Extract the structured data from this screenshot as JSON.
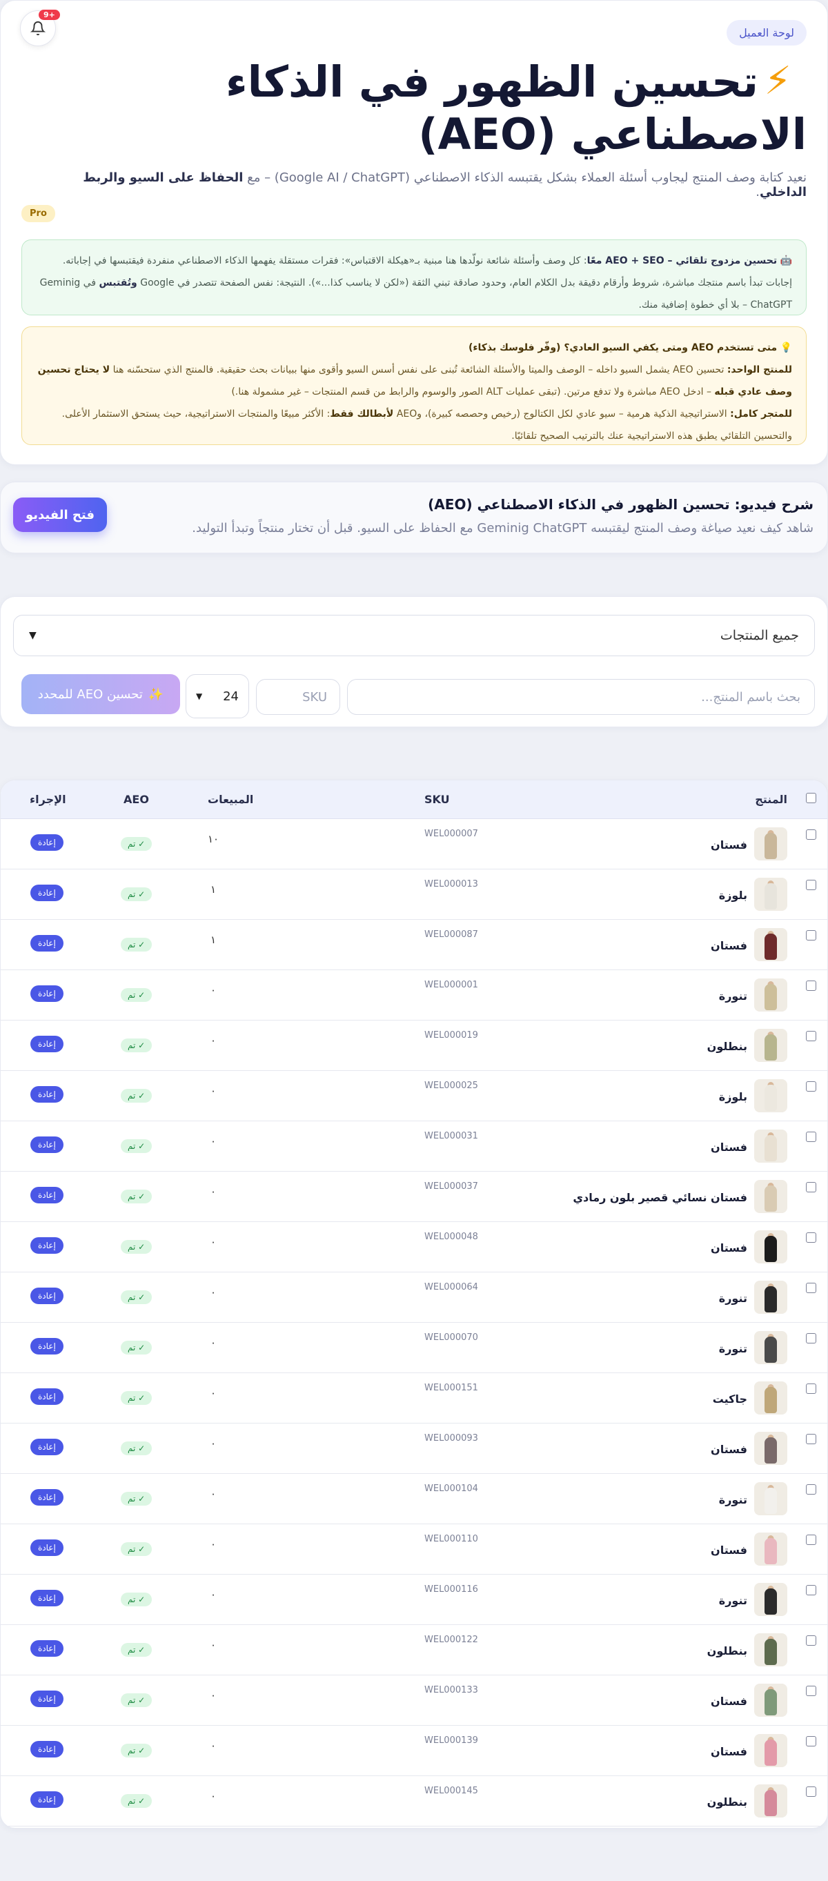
{
  "header": {
    "client_chip": "لوحة العميل",
    "notif_badge": "+9",
    "title_line1": "تحسين الظهور في الذكاء",
    "title_line2": "الاصطناعي (AEO)",
    "subtitle_pre": "نعيد كتابة وصف المنتج ليجاوب أسئلة العملاء بشكل يقتبسه الذكاء الاصطناعي (Google AI / ChatGPT) – مع",
    "subtitle_bold": "الحفاظ على السيو والربط الداخلي",
    "pro_badge": "Pro"
  },
  "info_green": {
    "icon": "🤖",
    "bold": "تحسين مزدوج تلقائي – AEO + SEO معًا",
    "text": ": كل وصف وأسئلة شائعة نولّدها هنا مبنية بـ«هيكلة الاقتباس»: فقرات مستقلة يفهمها الذكاء الاصطناعي منفردة فيقتبسها في إجاباته. إجابات تبدأ باسم منتجك مباشرة، شروط وأرقام دقيقة بدل الكلام العام، وحدود صادقة تبني الثقة («لكن لا يناسب كذا...»). النتيجة: نفس الصفحة تتصدر في Google",
    "bold2": "وتُقتبس",
    "text2": "في Geminig ChatGPT – بلا أي خطوة إضافية منك."
  },
  "info_yellow": {
    "icon": "💡",
    "title": "متى تستخدم AEO ومتى يكفي السيو العادي؟ (وفّر فلوسك بذكاء)",
    "l1_bold": "للمنتج الواحد:",
    "l1_text": "تحسين AEO يشمل السيو داخله – الوصف والميتا والأسئلة الشائعة تُبنى على نفس أسس السيو وأقوى منها ببيانات بحث حقيقية. فالمنتج الذي ستحسّنه هنا",
    "l1_bold2": "لا يحتاج تحسين وصف عادي قبله",
    "l1_text2": "– ادخل AEO مباشرة ولا تدفع مرتين. (تبقى عمليات ALT الصور والوسوم والرابط من قسم المنتجات – غير مشمولة هنا.)",
    "l2_bold": "للمتجر كامل:",
    "l2_text": "الاستراتيجية الذكية هرمية – سيو عادي لكل الكتالوج (رخيص وحصصه كبيرة)، وAEO",
    "l2_bold2": "لأبطالك فقط",
    "l2_text2": ": الأكثر مبيعًا والمنتجات الاستراتيجية، حيث يستحق الاستثمار الأعلى. والتحسين التلقائي يطبق هذه الاستراتيجية عنك بالترتيب الصحيح تلقائيًا."
  },
  "video": {
    "title": "شرح فيديو: تحسين الظهور في الذكاء الاصطناعي (AEO)",
    "subtitle": "شاهد كيف نعيد صياغة وصف المنتج ليقتبسه Geminig ChatGPT مع الحفاظ على السيو. قبل أن تختار منتجاً وتبدأ التوليد.",
    "button": "فتح الفيديو"
  },
  "filters": {
    "category_select": "جميع المنتجات",
    "search_placeholder": "بحث باسم المنتج...",
    "sku_placeholder": "SKU",
    "per_page": "24",
    "optimize_button": "تحسين AEO للمحدد",
    "optimize_icon": "✨"
  },
  "table": {
    "headers": {
      "product": "المنتج",
      "sku": "SKU",
      "sales": "المبيعات",
      "aeo": "AEO",
      "action": "الإجراء"
    },
    "rows": [
      {
        "name": "فستان",
        "sku": "WEL000007",
        "sales": "١٠",
        "aeo": "✓ تم",
        "action": "إعادة",
        "color": "#c9b79a"
      },
      {
        "name": "بلوزة",
        "sku": "WEL000013",
        "sales": "١",
        "aeo": "✓ تم",
        "action": "إعادة",
        "color": "#e7e4dc"
      },
      {
        "name": "فستان",
        "sku": "WEL000087",
        "sales": "١",
        "aeo": "✓ تم",
        "action": "إعادة",
        "color": "#6e2b2b"
      },
      {
        "name": "تنورة",
        "sku": "WEL000001",
        "sales": "٠",
        "aeo": "✓ تم",
        "action": "إعادة",
        "color": "#cdbf9a"
      },
      {
        "name": "بنطلون",
        "sku": "WEL000019",
        "sales": "٠",
        "aeo": "✓ تم",
        "action": "إعادة",
        "color": "#b7b58e"
      },
      {
        "name": "بلوزة",
        "sku": "WEL000025",
        "sales": "٠",
        "aeo": "✓ تم",
        "action": "إعادة",
        "color": "#ece8df"
      },
      {
        "name": "فستان",
        "sku": "WEL000031",
        "sales": "٠",
        "aeo": "✓ تم",
        "action": "إعادة",
        "color": "#e8e0d2"
      },
      {
        "name": "فستان نسائي قصير بلون رمادي",
        "sku": "WEL000037",
        "sales": "٠",
        "aeo": "✓ تم",
        "action": "إعادة",
        "color": "#d9cbb3"
      },
      {
        "name": "فستان",
        "sku": "WEL000048",
        "sales": "٠",
        "aeo": "✓ تم",
        "action": "إعادة",
        "color": "#1c1c1c"
      },
      {
        "name": "تنورة",
        "sku": "WEL000064",
        "sales": "٠",
        "aeo": "✓ تم",
        "action": "إعادة",
        "color": "#2a2a2a"
      },
      {
        "name": "تنورة",
        "sku": "WEL000070",
        "sales": "٠",
        "aeo": "✓ تم",
        "action": "إعادة",
        "color": "#4a4a4a"
      },
      {
        "name": "جاكيت",
        "sku": "WEL000151",
        "sales": "٠",
        "aeo": "✓ تم",
        "action": "إعادة",
        "color": "#bfa779"
      },
      {
        "name": "فستان",
        "sku": "WEL000093",
        "sales": "٠",
        "aeo": "✓ تم",
        "action": "إعادة",
        "color": "#7a6a6a"
      },
      {
        "name": "تنورة",
        "sku": "WEL000104",
        "sales": "٠",
        "aeo": "✓ تم",
        "action": "إعادة",
        "color": "#f2f0ec"
      },
      {
        "name": "فستان",
        "sku": "WEL000110",
        "sales": "٠",
        "aeo": "✓ تم",
        "action": "إعادة",
        "color": "#e9b8bf"
      },
      {
        "name": "تنورة",
        "sku": "WEL000116",
        "sales": "٠",
        "aeo": "✓ تم",
        "action": "إعادة",
        "color": "#2b2b2b"
      },
      {
        "name": "بنطلون",
        "sku": "WEL000122",
        "sales": "٠",
        "aeo": "✓ تم",
        "action": "إعادة",
        "color": "#5d6b4e"
      },
      {
        "name": "فستان",
        "sku": "WEL000133",
        "sales": "٠",
        "aeo": "✓ تم",
        "action": "إعادة",
        "color": "#7f9a7a"
      },
      {
        "name": "فستان",
        "sku": "WEL000139",
        "sales": "٠",
        "aeo": "✓ تم",
        "action": "إعادة",
        "color": "#e39aa9"
      },
      {
        "name": "بنطلون",
        "sku": "WEL000145",
        "sales": "٠",
        "aeo": "✓ تم",
        "action": "إعادة",
        "color": "#d58a9b"
      }
    ]
  }
}
